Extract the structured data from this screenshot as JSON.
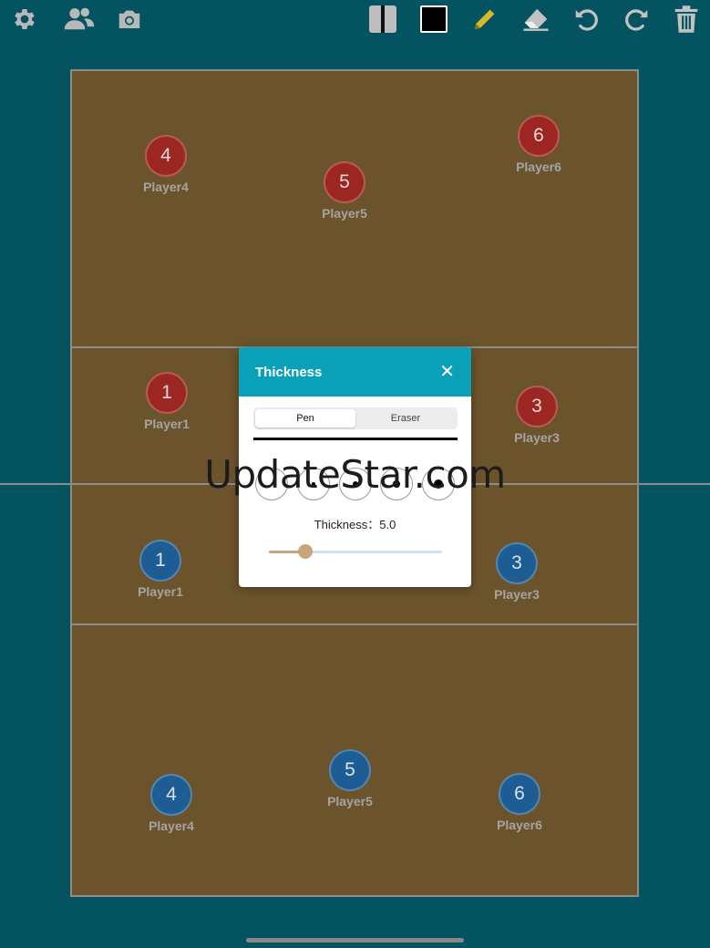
{
  "toolbar": {
    "left": [
      {
        "name": "settings-gear-icon",
        "icon": "gear"
      },
      {
        "name": "players-icon",
        "icon": "people"
      },
      {
        "name": "camera-icon",
        "icon": "camera"
      }
    ],
    "right": [
      {
        "name": "line-style-icon",
        "icon": "line-style"
      },
      {
        "name": "color-swatch-icon",
        "icon": "color-swatch",
        "color": "#000000"
      },
      {
        "name": "pencil-icon",
        "icon": "pencil",
        "color": "#d9b826"
      },
      {
        "name": "eraser-icon",
        "icon": "eraser"
      },
      {
        "name": "undo-icon",
        "icon": "undo"
      },
      {
        "name": "redo-icon",
        "icon": "redo"
      },
      {
        "name": "trash-icon",
        "icon": "trash"
      }
    ]
  },
  "colors": {
    "background": "#035361",
    "court": "#6b542c",
    "court_line": "#8c8c8c",
    "red_team": "#9c2622",
    "blue_team": "#1d5d94",
    "dialog_header": "#0aa0b8",
    "slider_fill": "#c9a57e"
  },
  "red_team": [
    {
      "number": "4",
      "name": "Player4"
    },
    {
      "number": "5",
      "name": "Player5"
    },
    {
      "number": "6",
      "name": "Player6"
    },
    {
      "number": "1",
      "name": "Player1"
    },
    {
      "number": "3",
      "name": "Player3"
    }
  ],
  "blue_team": [
    {
      "number": "1",
      "name": "Player1"
    },
    {
      "number": "3",
      "name": "Player3"
    },
    {
      "number": "4",
      "name": "Player4"
    },
    {
      "number": "5",
      "name": "Player5"
    },
    {
      "number": "6",
      "name": "Player6"
    }
  ],
  "dialog": {
    "title": "Thickness",
    "close_icon": "close",
    "tabs": [
      "Pen",
      "Eraser"
    ],
    "active_tab": "Pen",
    "size_options": 5,
    "thickness_label": "Thickness：5.0",
    "thickness_value": 5.0,
    "thickness_fraction": 0.21
  },
  "watermark": "UpdateStar.com"
}
